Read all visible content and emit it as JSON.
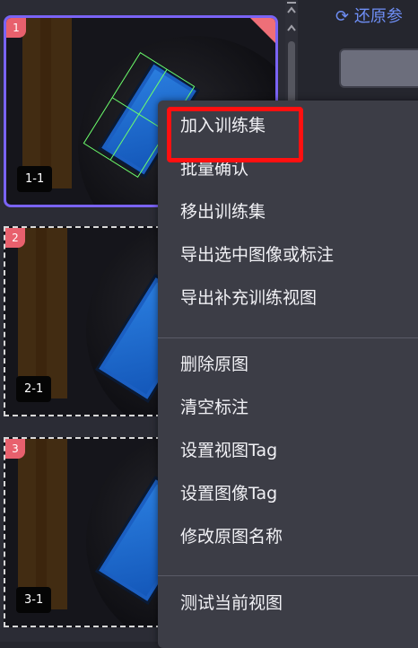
{
  "thumbnails": [
    {
      "index": "1",
      "label": "1-1",
      "selected": true
    },
    {
      "index": "2",
      "label": "2-1",
      "selected": false
    },
    {
      "index": "3",
      "label": "3-1",
      "selected": false
    }
  ],
  "toolbar": {
    "restore_label": "还原参"
  },
  "context_menu": {
    "groups": [
      [
        "加入训练集",
        "批量确认",
        "移出训练集",
        "导出选中图像或标注",
        "导出补充训练视图"
      ],
      [
        "删除原图",
        "清空标注",
        "设置视图Tag",
        "设置图像Tag",
        "修改原图名称"
      ],
      [
        "测试当前视图"
      ]
    ],
    "highlighted_item": "加入训练集",
    "highlight_color": "#ff1010"
  },
  "colors": {
    "accent": "#7a63f5",
    "badge": "#e8606d",
    "part_blue": "#2b7fe0"
  },
  "icons": {
    "scroll_top": "collapse-up-icon",
    "scroll_up": "chevron-up-icon",
    "restore": "refresh-icon"
  }
}
